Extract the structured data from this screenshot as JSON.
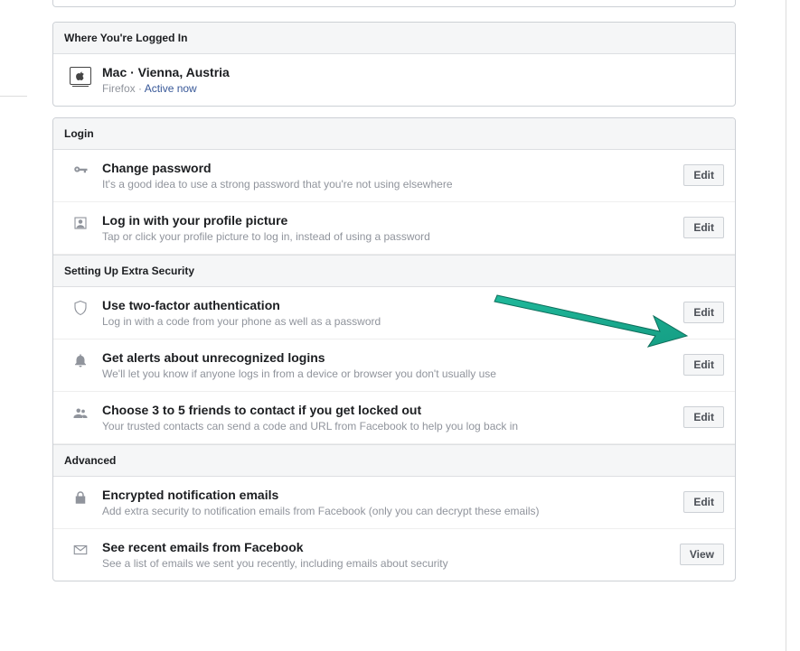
{
  "sections": {
    "logged_in": {
      "header": "Where You're Logged In",
      "device": {
        "line1": "Mac · Vienna, Austria",
        "browser": "Firefox · ",
        "status": "Active now"
      }
    },
    "login": {
      "header": "Login",
      "change_password": {
        "title": "Change password",
        "sub": "It's a good idea to use a strong password that you're not using elsewhere",
        "btn": "Edit"
      },
      "profile_picture": {
        "title": "Log in with your profile picture",
        "sub": "Tap or click your profile picture to log in, instead of using a password",
        "btn": "Edit"
      }
    },
    "extra": {
      "header": "Setting Up Extra Security",
      "two_factor": {
        "title": "Use two-factor authentication",
        "sub": "Log in with a code from your phone as well as a password",
        "btn": "Edit"
      },
      "alerts": {
        "title": "Get alerts about unrecognized logins",
        "sub": "We'll let you know if anyone logs in from a device or browser you don't usually use",
        "btn": "Edit"
      },
      "friends": {
        "title": "Choose 3 to 5 friends to contact if you get locked out",
        "sub": "Your trusted contacts can send a code and URL from Facebook to help you log back in",
        "btn": "Edit"
      }
    },
    "advanced": {
      "header": "Advanced",
      "encrypted": {
        "title": "Encrypted notification emails",
        "sub": "Add extra security to notification emails from Facebook (only you can decrypt these emails)",
        "btn": "Edit"
      },
      "recent_emails": {
        "title": "See recent emails from Facebook",
        "sub": "See a list of emails we sent you recently, including emails about security",
        "btn": "View"
      }
    }
  }
}
